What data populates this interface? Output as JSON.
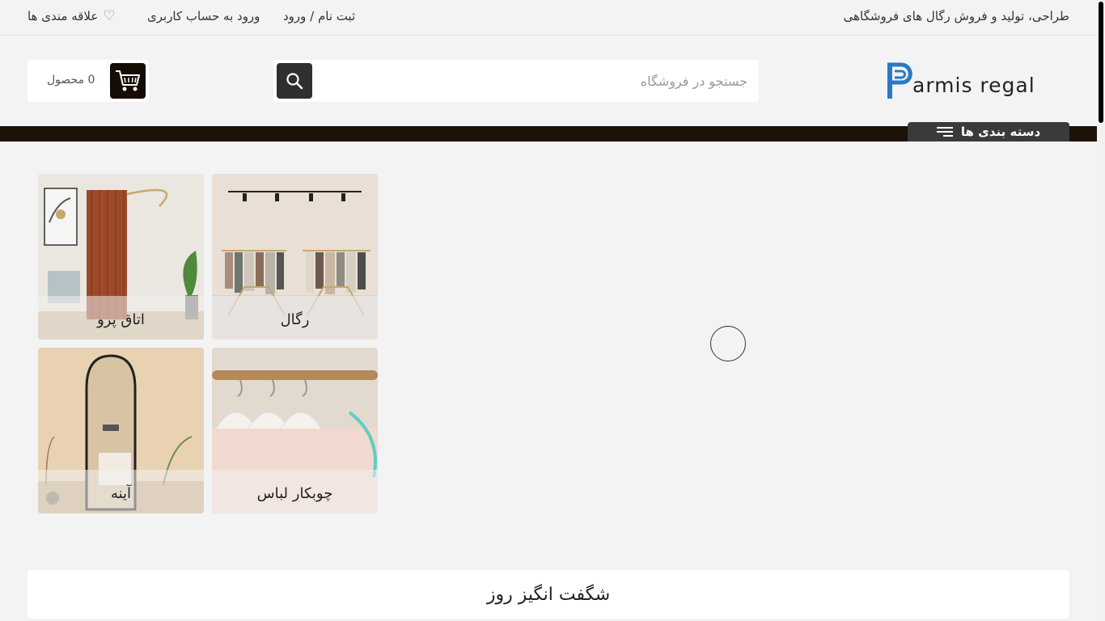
{
  "topbar": {
    "tagline": "طراحی، تولید و فروش رگال های فروشگاهی",
    "register": "ثبت نام / ورود",
    "login": "ورود به حساب کاربری",
    "wishlist": "علاقه مندی ها"
  },
  "logo": {
    "text": "armis regal",
    "brand_color": "#2a79c6"
  },
  "search": {
    "placeholder": "جستجو در فروشگاه",
    "value": ""
  },
  "cart": {
    "count_label": "0 محصول"
  },
  "nav": {
    "categories_label": "دسته بندی ها"
  },
  "categories": [
    {
      "label": "رگال"
    },
    {
      "label": "اتاق پرو"
    },
    {
      "label": "چوبکار لباس"
    },
    {
      "label": "آینه"
    }
  ],
  "deals": {
    "title": "شگفت انگیز روز"
  },
  "colors": {
    "navbar": "#1c1208",
    "cart_button": "#160c04",
    "search_button": "#2f2f2f"
  }
}
